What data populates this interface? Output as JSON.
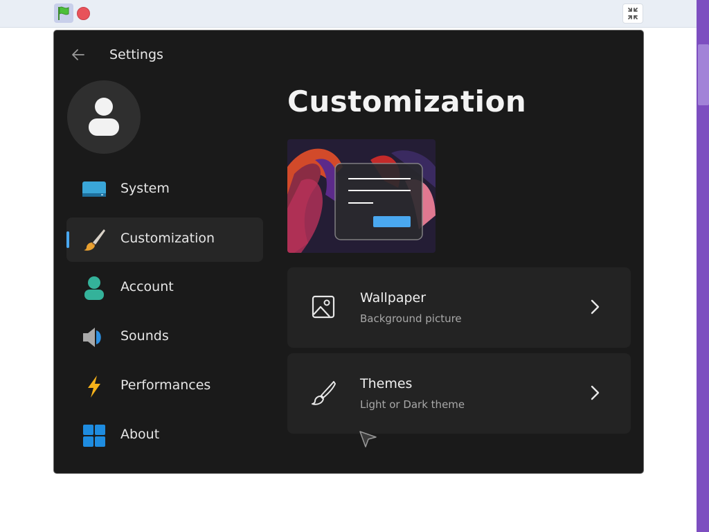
{
  "toolbar": {
    "green_flag_icon": "green-flag-icon",
    "stop_icon": "stop-icon",
    "fullscreen_icon": "exit-fullscreen-icon"
  },
  "app": {
    "title": "Settings",
    "back_icon": "back-arrow-icon",
    "avatar_icon": "user-avatar-icon"
  },
  "sidebar": {
    "items": [
      {
        "label": "System",
        "icon": "monitor-icon",
        "active": false
      },
      {
        "label": "Customization",
        "icon": "paintbrush-icon",
        "active": true
      },
      {
        "label": "Account",
        "icon": "person-icon",
        "active": false
      },
      {
        "label": "Sounds",
        "icon": "speaker-icon",
        "active": false
      },
      {
        "label": "Performances",
        "icon": "lightning-icon",
        "active": false
      },
      {
        "label": "About",
        "icon": "windows-logo-icon",
        "active": false
      }
    ]
  },
  "main": {
    "heading": "Customization",
    "cards": [
      {
        "title": "Wallpaper",
        "subtitle": "Background picture",
        "icon": "image-icon"
      },
      {
        "title": "Themes",
        "subtitle": "Light or Dark theme",
        "icon": "brush-icon"
      }
    ]
  },
  "colors": {
    "background": "#1a1a1a",
    "card": "#232323",
    "accent": "#4aa8f0",
    "scrollbar": "#7d4ec0"
  }
}
